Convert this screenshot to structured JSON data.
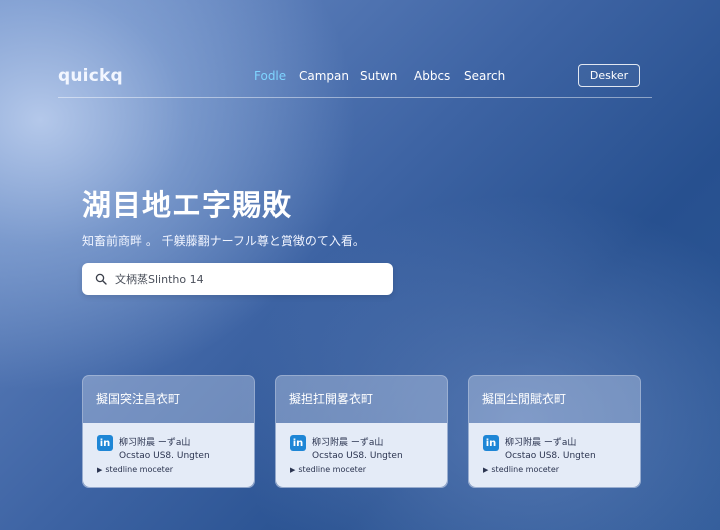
{
  "header": {
    "logo": "quickq",
    "nav": [
      "Fodle",
      "Campan",
      "Sutwn",
      "Abbcs",
      "Search"
    ],
    "cta": "Desker"
  },
  "hero": {
    "title": "湖目地エ字賜敗",
    "subtitle": "知畜前商畔 。 千躾藤翻ナーフル尊と賞徴のて入看。"
  },
  "search": {
    "placeholder": "文柄蒸Slintho 14"
  },
  "cards": [
    {
      "title": "擬国突注昌衣町",
      "line1": "柳习附晨 ーずа山",
      "line2": "Ocstao US8. Ungten",
      "line3": "stedline moceter"
    },
    {
      "title": "擬担扛開畧衣町",
      "line1": "柳习附晨 ーずа山",
      "line2": "Ocstao US8. Ungten",
      "line3": "stedline moceter"
    },
    {
      "title": "擬国尘閒賦衣町",
      "line1": "柳习附晨 ーずа山",
      "line2": "Ocstao US8. Ungten",
      "line3": "stedline moceter"
    }
  ],
  "colors": {
    "nav_active": "#7fd4ff",
    "linkedin_blue": "#1e86d6"
  },
  "icons": {
    "search": "search-icon",
    "card": "linkedin-icon"
  }
}
